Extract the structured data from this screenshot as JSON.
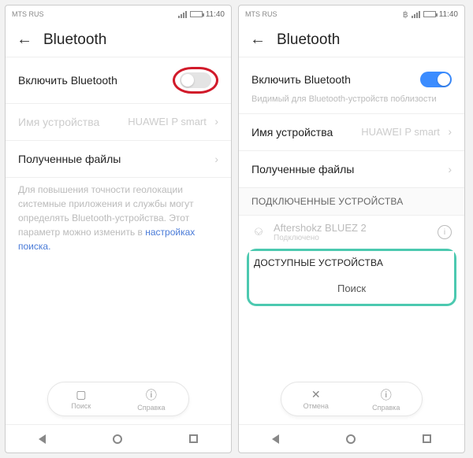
{
  "left": {
    "status": {
      "carrier": "MTS RUS",
      "time": "11:40"
    },
    "title": "Bluetooth",
    "toggle": {
      "label": "Включить Bluetooth",
      "state": "off"
    },
    "deviceName": {
      "label": "Имя устройства",
      "value": "HUAWEI P smart"
    },
    "receivedFiles": "Полученные файлы",
    "helpText": "Для повышения точности геолокации системные приложения и службы могут определять Bluetooth-устройства. Этот параметр можно изменить в ",
    "helpLink": "настройках поиска.",
    "pill": {
      "left": "Поиск",
      "right": "Справка"
    }
  },
  "right": {
    "status": {
      "carrier": "MTS RUS",
      "time": "11:40"
    },
    "title": "Bluetooth",
    "toggle": {
      "label": "Включить Bluetooth",
      "state": "on"
    },
    "visibility": "Видимый для Bluetooth-устройств поблизости",
    "deviceName": {
      "label": "Имя устройства",
      "value": "HUAWEI P smart"
    },
    "receivedFiles": "Полученные файлы",
    "sectionConnected": "ПОДКЛЮЧЕННЫЕ УСТРОЙСТВА",
    "deviceConnected": {
      "name": "Aftershokz BLUEZ 2",
      "status": "Подключено"
    },
    "sectionAvailable": "ДОСТУПНЫЕ УСТРОЙСТВА",
    "searching": "Поиск",
    "pill": {
      "left": "Отмена",
      "right": "Справка"
    }
  }
}
